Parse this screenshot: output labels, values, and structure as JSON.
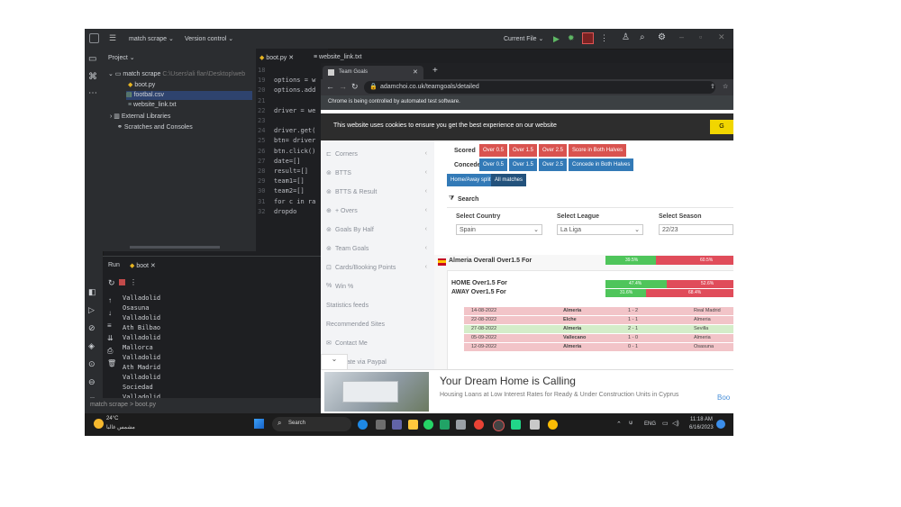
{
  "ide": {
    "project_name": "match scrape",
    "version_control": "Version control",
    "current_file": "Current File",
    "project_label": "Project",
    "tree": {
      "root": "match scrape",
      "root_path": "C:\\Users\\ali flan\\Desktop\\web",
      "files": [
        "boot.py",
        "footbal.csv",
        "website_link.txt"
      ],
      "external": "External Libraries",
      "scratches": "Scratches and Consoles"
    },
    "editor_tabs": [
      "boot.py",
      "website_link.txt"
    ],
    "code": [
      {
        "num": "18",
        "text": ""
      },
      {
        "num": "19",
        "text": "options = w"
      },
      {
        "num": "20",
        "text": "options.add"
      },
      {
        "num": "21",
        "text": ""
      },
      {
        "num": "22",
        "text": "driver = we"
      },
      {
        "num": "23",
        "text": ""
      },
      {
        "num": "24",
        "text": "driver.get("
      },
      {
        "num": "25",
        "text": "btn= driver"
      },
      {
        "num": "26",
        "text": "btn.click()"
      },
      {
        "num": "27",
        "text": "date=[]"
      },
      {
        "num": "28",
        "text": "result=[]"
      },
      {
        "num": "29",
        "text": "team1=[]"
      },
      {
        "num": "30",
        "text": "team2=[]"
      },
      {
        "num": "31",
        "text": "for c in ra"
      },
      {
        "num": "32",
        "text": "  dropdo"
      }
    ],
    "run_label": "Run",
    "run_tab": "boot",
    "output": [
      "Valladolid",
      "Osasuna",
      "Valladolid",
      "Ath Bilbao",
      "Valladolid",
      "Mallorca",
      "Valladolid",
      "Ath Madrid",
      "Valladolid",
      "Sociedad",
      "Valladolid",
      "Betis",
      "Celta"
    ],
    "statusbar": "match scrape  >  boot.py"
  },
  "browser": {
    "tab_title": "Team Goals",
    "url": "adamchoi.co.uk/teamgoals/detailed",
    "automation_msg": "Chrome is being controlled by automated test software.",
    "cookie_msg": "This website uses cookies to ensure you get the best experience on our website",
    "cookie_btn": "G",
    "sidebar": [
      {
        "label": "Corners",
        "arrow": "‹"
      },
      {
        "label": "BTTS",
        "arrow": "‹"
      },
      {
        "label": "BTTS & Result",
        "arrow": "‹"
      },
      {
        "label": "+ Overs",
        "arrow": "‹"
      },
      {
        "label": "Goals By Half",
        "arrow": "‹"
      },
      {
        "label": "Team Goals",
        "arrow": "‹"
      },
      {
        "label": "Cards/Booking Points",
        "arrow": "‹"
      },
      {
        "label": "Win %",
        "arrow": ""
      },
      {
        "label": "Statistics feeds",
        "arrow": ""
      },
      {
        "label": "Recommended Sites",
        "arrow": ""
      },
      {
        "label": "Contact Me",
        "arrow": ""
      },
      {
        "label": "Donate via Paypal",
        "arrow": ""
      }
    ],
    "scored_label": "Scored",
    "scored_buttons": [
      "Over 0.5",
      "Over 1.5",
      "Over 2.5",
      "Score in Both Halves"
    ],
    "conceded_label": "Conceded",
    "conceded_buttons": [
      "Over 0.5",
      "Over 1.5",
      "Over 2.5",
      "Concede in Both Halves"
    ],
    "split_buttons": [
      "Home/Away split",
      "All matches"
    ],
    "search_title": "Search",
    "country_label": "Select Country",
    "country_value": "Spain",
    "league_label": "Select League",
    "league_value": "La Liga",
    "season_label": "Select Season",
    "season_value": "22/23",
    "team_title": "Almeria Overall Over1.5 For",
    "overall_green": "39.5%",
    "overall_red": "60.5%",
    "home_label": "HOME Over1.5 For",
    "home_green": "47.4%",
    "home_red": "52.6%",
    "away_label": "AWAY Over1.5 For",
    "away_green": "31.6%",
    "away_red": "68.4%",
    "matches": [
      {
        "date": "14-08-2022",
        "home": "Almeria",
        "score": "1 - 2",
        "away": "Real Madrid",
        "status": "red"
      },
      {
        "date": "22-08-2022",
        "home": "Elche",
        "score": "1 - 1",
        "away": "Almeria",
        "status": "red"
      },
      {
        "date": "27-08-2022",
        "home": "Almeria",
        "score": "2 - 1",
        "away": "Sevilla",
        "status": "green"
      },
      {
        "date": "05-09-2022",
        "home": "Vallecano",
        "score": "1 - 0",
        "away": "Almeria",
        "status": "red"
      },
      {
        "date": "12-09-2022",
        "home": "Almeria",
        "score": "0 - 1",
        "away": "Osasuna",
        "status": "red"
      }
    ],
    "ad_title": "Your Dream Home is Calling",
    "ad_text": "Housing Loans at Low Interest Rates for Ready & Under Construction Units in Cyprus",
    "ad_link": "Boo"
  },
  "taskbar": {
    "temp": "24°C",
    "weather": "مشمس غالبا",
    "search": "Search",
    "lang": "ENG",
    "time": "11:18 AM",
    "date": "6/16/2023"
  },
  "colors": {
    "green": "#5cb85c",
    "red": "#d9534f",
    "blue": "#337ab7"
  }
}
